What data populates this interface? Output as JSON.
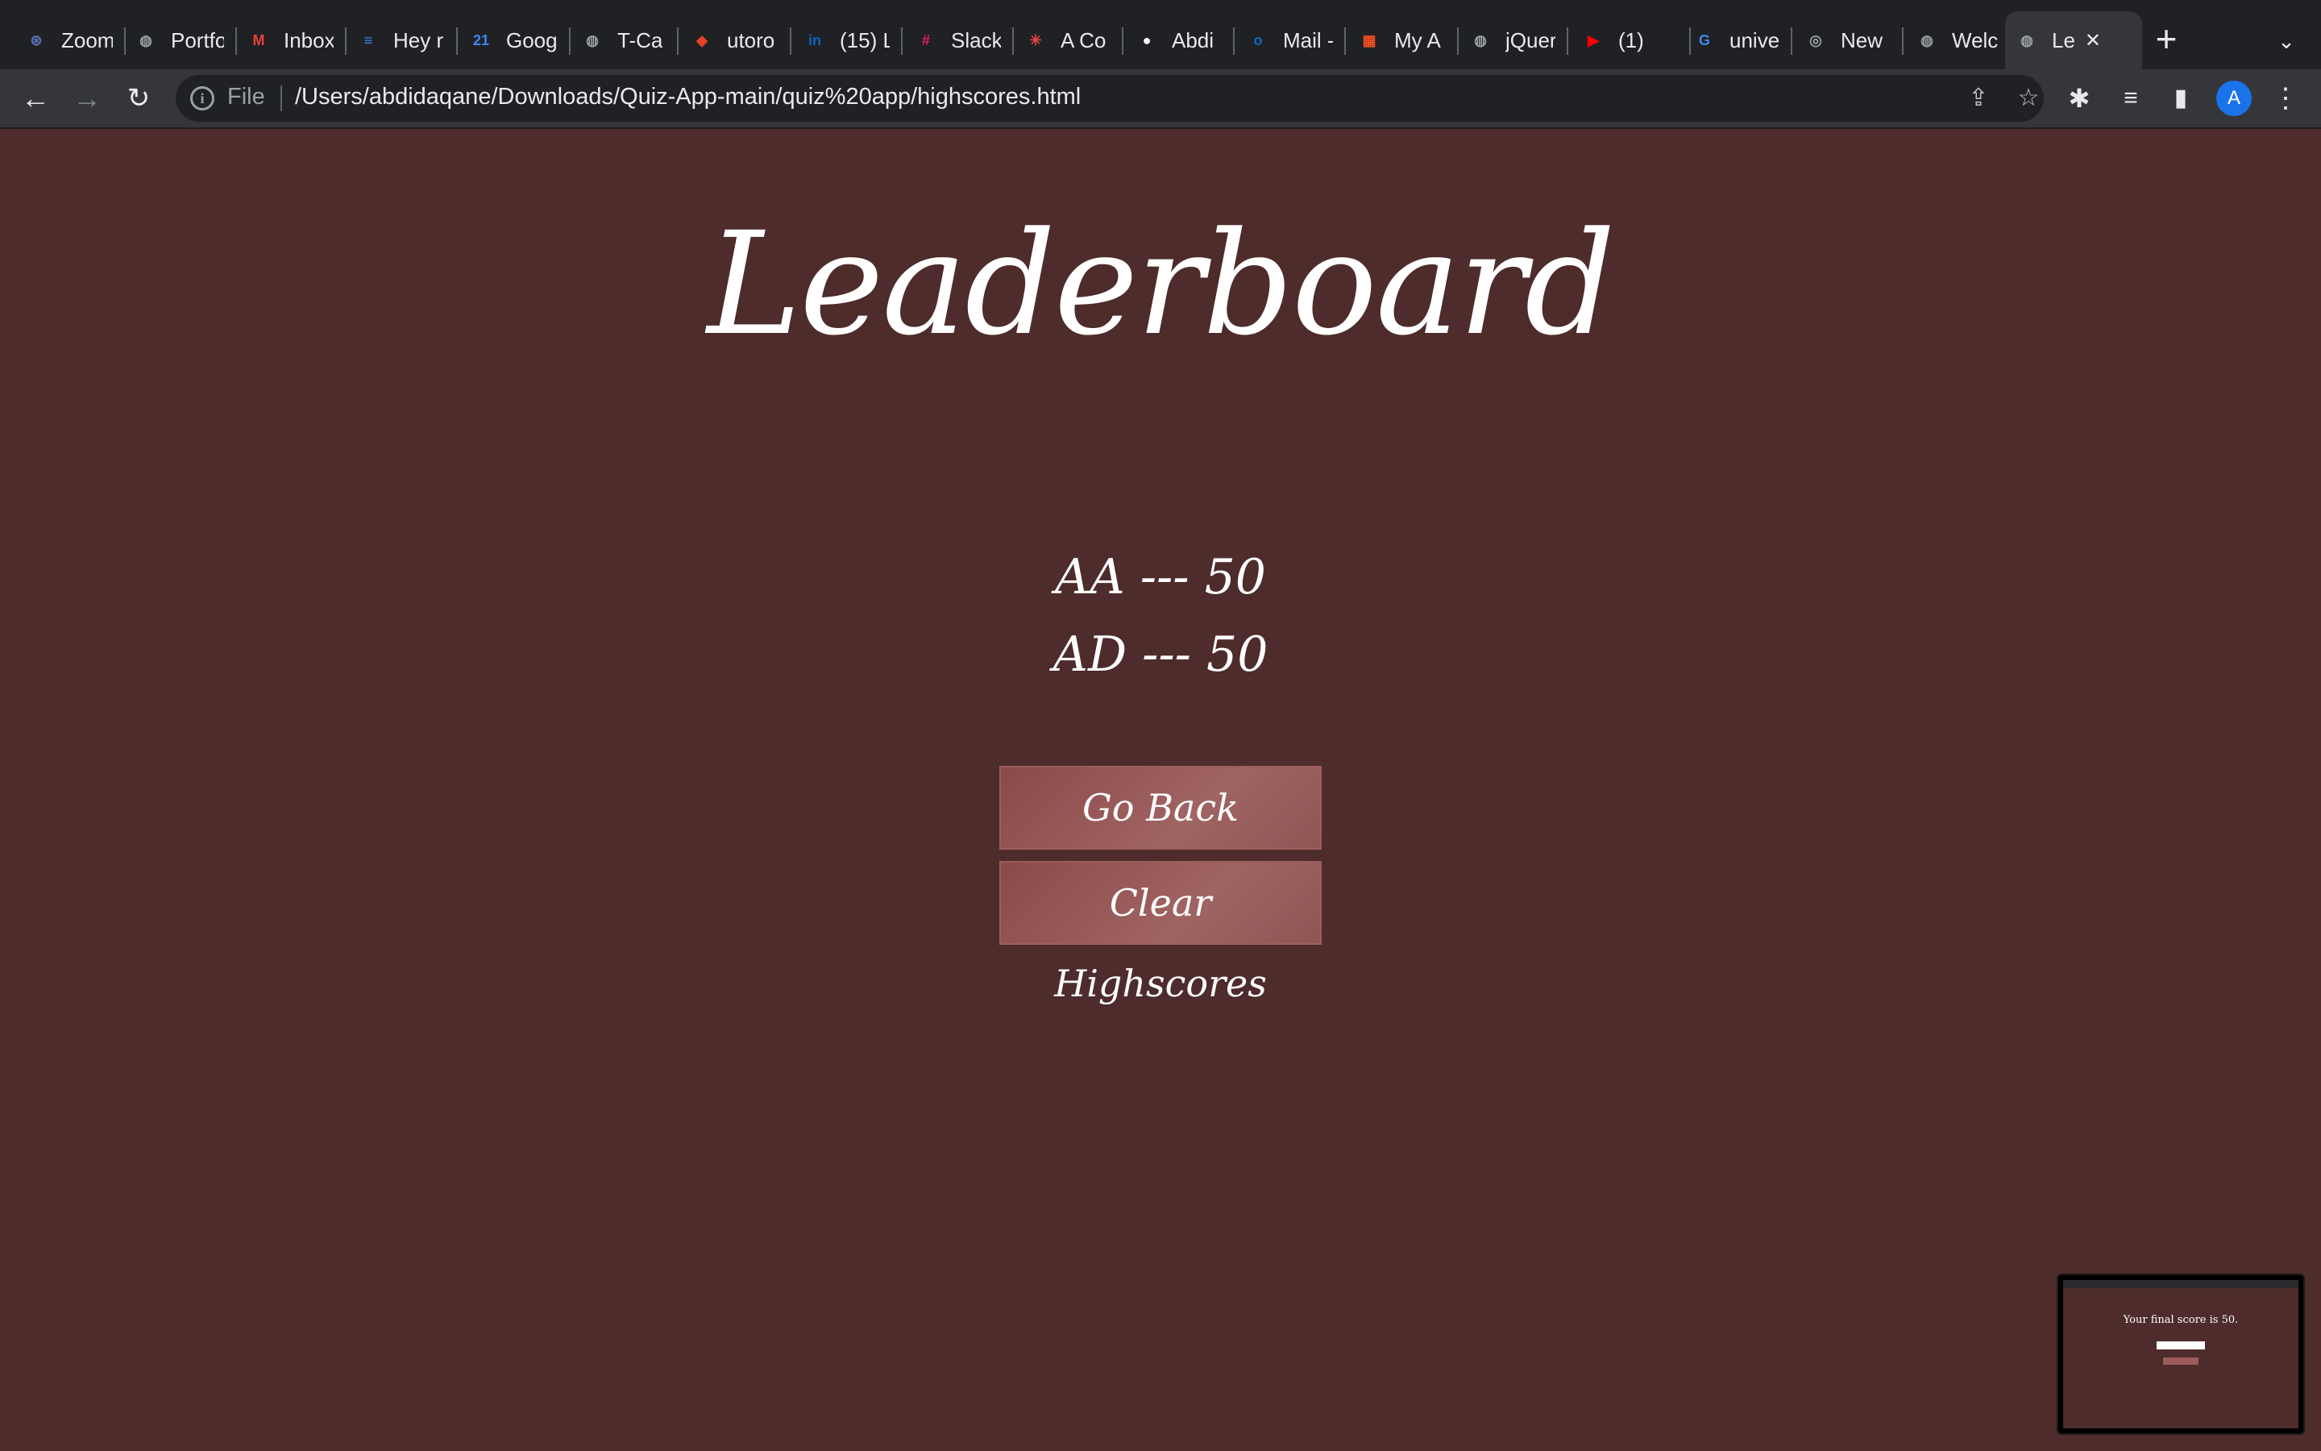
{
  "browser": {
    "tabs": [
      {
        "title": "Zoom",
        "icon": "zoom-icon",
        "color": "#5b6fb6"
      },
      {
        "title": "Portfolio",
        "icon": "globe-icon",
        "color": "#9aa0a6"
      },
      {
        "title": "Inbox",
        "icon": "gmail-icon",
        "color": "#ea4335"
      },
      {
        "title": "Hey r",
        "icon": "docs-icon",
        "color": "#4285f4"
      },
      {
        "title": "Google",
        "icon": "calendar-icon",
        "color": "#4285f4"
      },
      {
        "title": "T-Ca",
        "icon": "globe-icon",
        "color": "#9aa0a6"
      },
      {
        "title": "utoro",
        "icon": "gitlab-icon",
        "color": "#e24329"
      },
      {
        "title": "(15) L",
        "icon": "linkedin-icon",
        "color": "#0a66c2"
      },
      {
        "title": "Slack",
        "icon": "slack-icon",
        "color": "#e01e5a"
      },
      {
        "title": "A Co",
        "icon": "asterisk-icon",
        "color": "#e8453c"
      },
      {
        "title": "Abdi",
        "icon": "github-icon",
        "color": "#ffffff"
      },
      {
        "title": "Mail -",
        "icon": "outlook-icon",
        "color": "#0f6cbd"
      },
      {
        "title": "My A",
        "icon": "microsoft-icon",
        "color": "#f25022"
      },
      {
        "title": "jQuer",
        "icon": "globe-icon",
        "color": "#9aa0a6"
      },
      {
        "title": "(1)",
        "icon": "youtube-icon",
        "color": "#ff0000"
      },
      {
        "title": "unive",
        "icon": "google-icon",
        "color": "#4285f4"
      },
      {
        "title": "New",
        "icon": "chrome-icon",
        "color": "#9aa0a6"
      },
      {
        "title": "Welc",
        "icon": "globe-icon",
        "color": "#9aa0a6"
      },
      {
        "title": "Le",
        "icon": "globe-icon",
        "color": "#9aa0a6",
        "active": true
      }
    ],
    "omnibox": {
      "scheme_label": "File",
      "url": "/Users/abdidaqane/Downloads/Quiz-App-main/quiz%20app/highscores.html"
    },
    "avatar_letter": "A"
  },
  "page": {
    "title": "Leaderboard",
    "scores": [
      "AA --- 50",
      "AD --- 50"
    ],
    "go_back_label": "Go Back",
    "clear_label": "Clear Highscores"
  },
  "preview": {
    "text": "Your final score is 50."
  },
  "colors": {
    "page_bg": "#4d2c2b",
    "button_bg": "#a06463",
    "chrome_dark": "#202124",
    "chrome_toolbar": "#35363a"
  }
}
